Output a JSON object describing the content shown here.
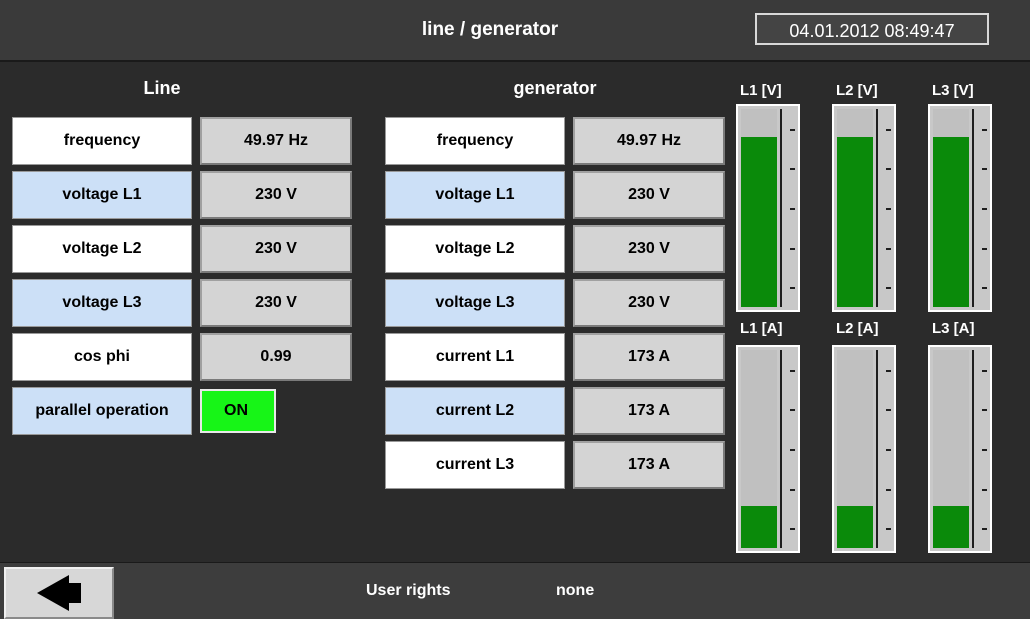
{
  "header": {
    "title": "line / generator",
    "datetime": "04.01.2012 08:49:47"
  },
  "line": {
    "heading": "Line",
    "rows": [
      {
        "label": "frequency",
        "value": "49.97 Hz"
      },
      {
        "label": "voltage L1",
        "value": "230 V"
      },
      {
        "label": "voltage L2",
        "value": "230 V"
      },
      {
        "label": "voltage L3",
        "value": "230 V"
      },
      {
        "label": "cos phi",
        "value": "0.99"
      }
    ],
    "parallel": {
      "label": "parallel operation",
      "status": "ON"
    }
  },
  "generator": {
    "heading": "generator",
    "rows": [
      {
        "label": "frequency",
        "value": "49.97 Hz"
      },
      {
        "label": "voltage L1",
        "value": "230 V"
      },
      {
        "label": "voltage L2",
        "value": "230 V"
      },
      {
        "label": "voltage L3",
        "value": "230 V"
      },
      {
        "label": "current L1",
        "value": "173 A"
      },
      {
        "label": "current L2",
        "value": "173 A"
      },
      {
        "label": "current L3",
        "value": "173 A"
      }
    ]
  },
  "bars": {
    "voltage": [
      {
        "label": "L1 [V]",
        "level": 0.86
      },
      {
        "label": "L2 [V]",
        "level": 0.86
      },
      {
        "label": "L3 [V]",
        "level": 0.86
      }
    ],
    "current": [
      {
        "label": "L1 [A]",
        "level": 0.21
      },
      {
        "label": "L2 [A]",
        "level": 0.21
      },
      {
        "label": "L3 [A]",
        "level": 0.21
      }
    ]
  },
  "footer": {
    "user_rights_label": "User rights",
    "user_rights_value": "none",
    "back_icon": "back-arrow-icon"
  },
  "colors": {
    "on_status": "#17f517",
    "bar_fill": "#0a8a0a",
    "blue_row": "#cce0f7"
  }
}
